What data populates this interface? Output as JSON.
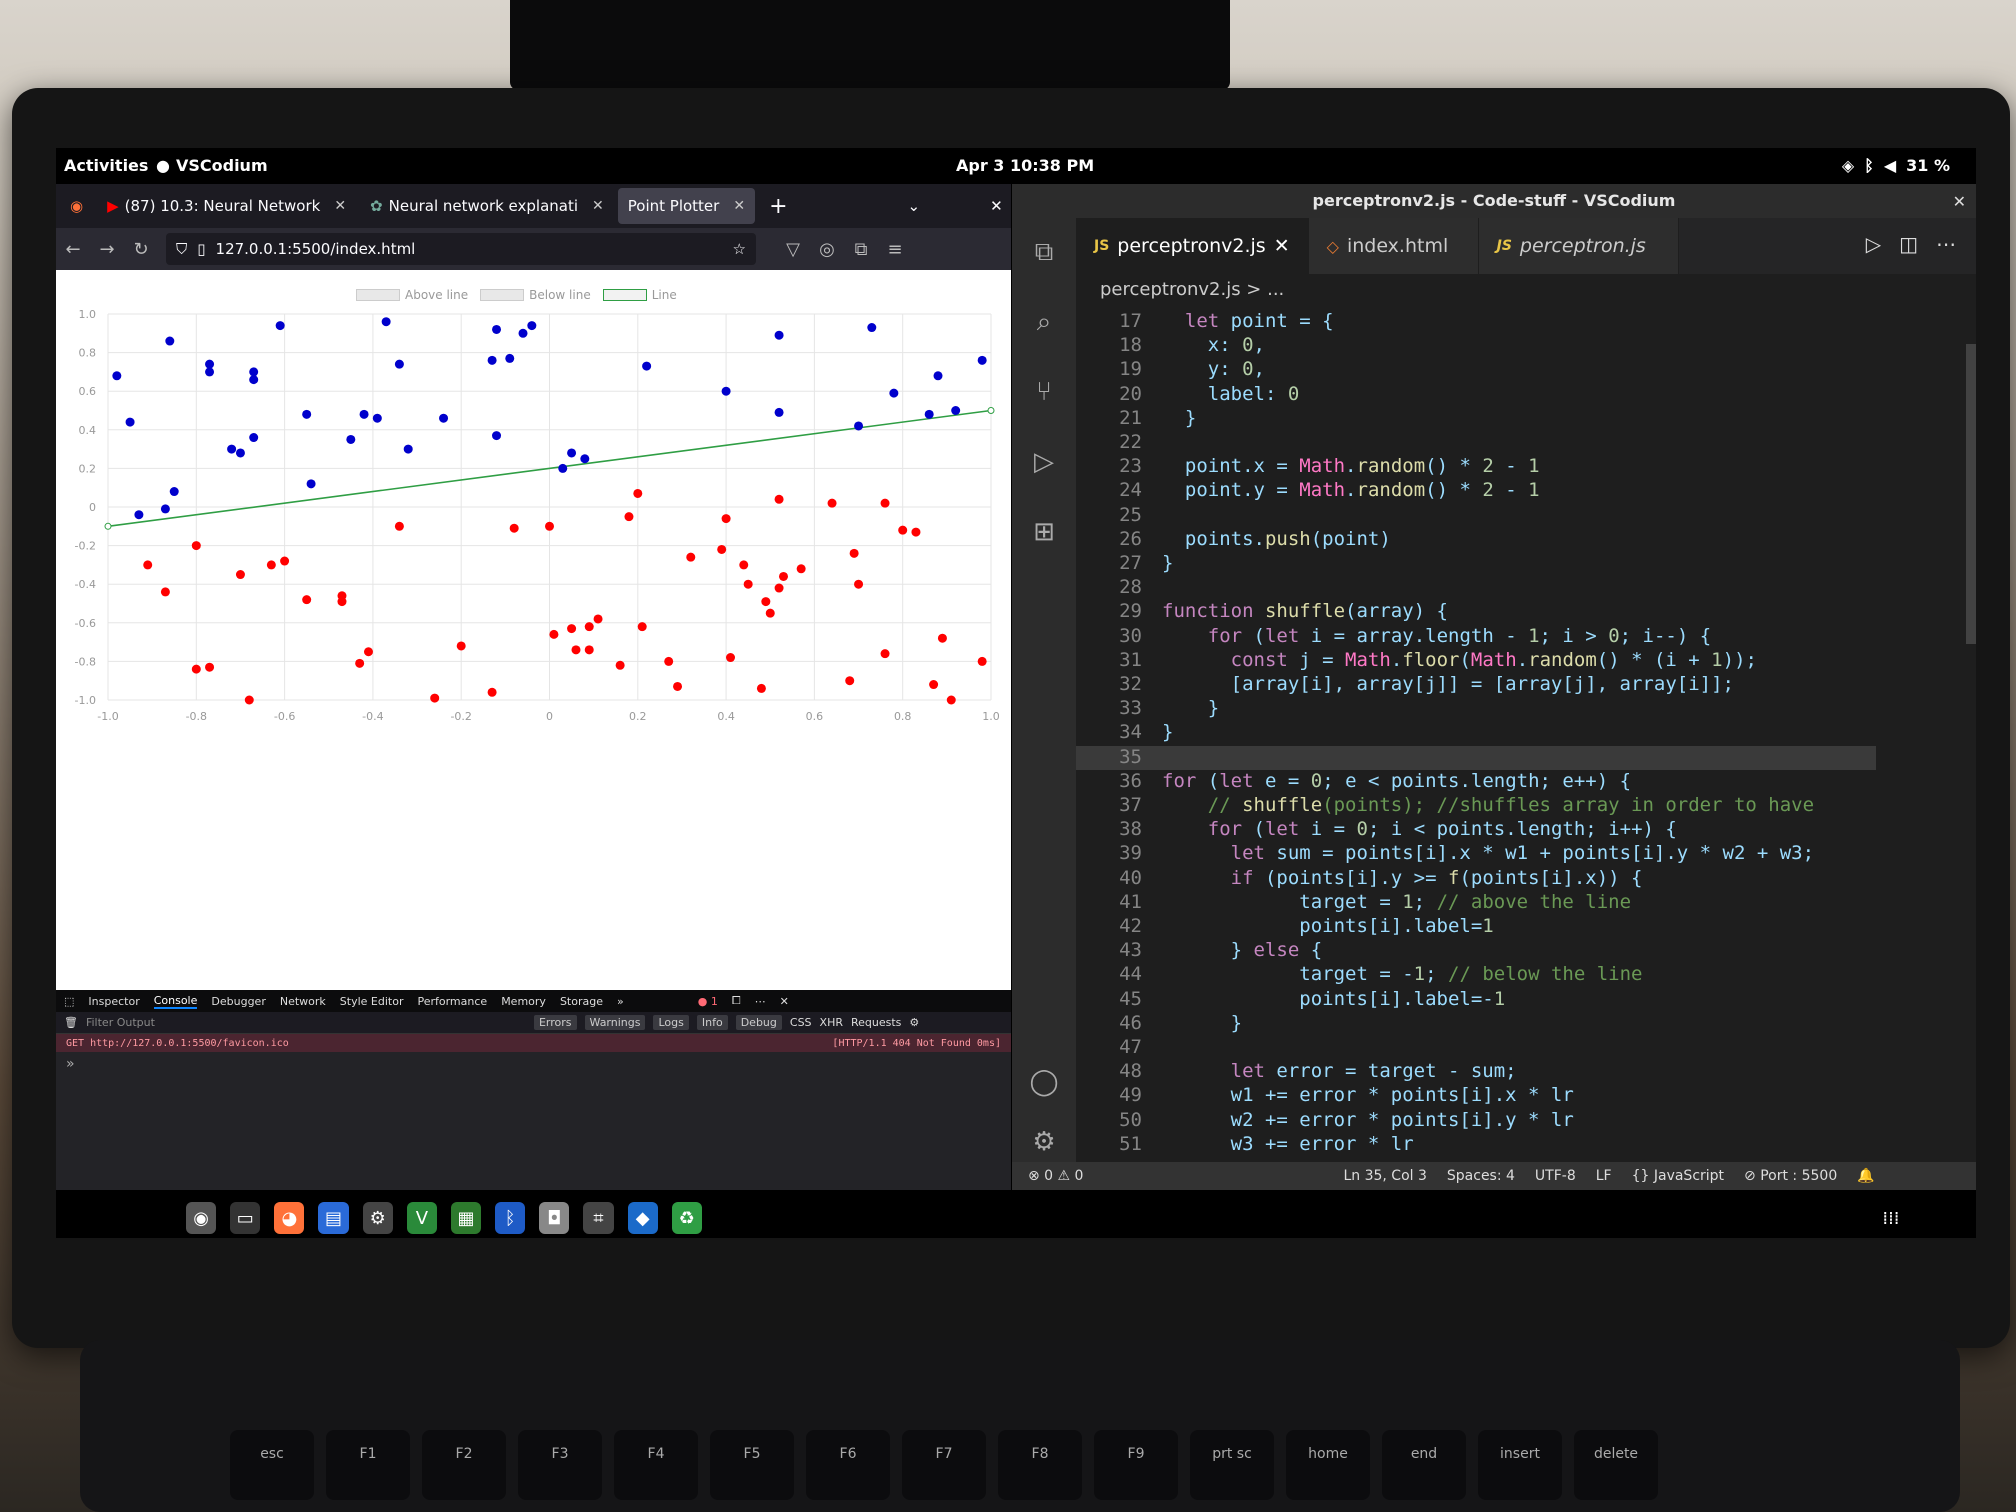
{
  "gnome": {
    "activities": "Activities",
    "app": "VSCodium",
    "clock": "Apr 3  10:38 PM",
    "battery": "31 %"
  },
  "firefox": {
    "tabs": [
      "(87) 10.3: Neural Network",
      "Neural network explanati",
      "Point Plotter"
    ],
    "url": "127.0.0.1:5500/index.html",
    "legend": [
      "Above line",
      "Below line",
      "Line"
    ],
    "devtools": {
      "tabs": [
        "Inspector",
        "Console",
        "Debugger",
        "Network",
        "Style Editor",
        "Performance",
        "Memory",
        "Storage"
      ],
      "filter": "Filter Output",
      "filters": [
        "Errors",
        "Warnings",
        "Logs",
        "Info",
        "Debug",
        "CSS",
        "XHR",
        "Requests"
      ],
      "error": "GET http://127.0.0.1:5500/favicon.ico",
      "error_status": "[HTTP/1.1 404 Not Found 0ms]",
      "prompt": "»",
      "error_count": "1"
    }
  },
  "chart_data": {
    "type": "scatter",
    "series": [
      {
        "name": "Above line",
        "color": "#0000cc",
        "points": [
          [
            -0.98,
            0.68
          ],
          [
            -0.95,
            0.44
          ],
          [
            -0.93,
            -0.04
          ],
          [
            -0.87,
            -0.01
          ],
          [
            -0.85,
            0.08
          ],
          [
            -0.86,
            0.86
          ],
          [
            -0.77,
            0.74
          ],
          [
            -0.77,
            0.7
          ],
          [
            -0.72,
            0.3
          ],
          [
            -0.7,
            0.28
          ],
          [
            -0.67,
            0.7
          ],
          [
            -0.67,
            0.66
          ],
          [
            -0.67,
            0.36
          ],
          [
            -0.61,
            0.94
          ],
          [
            -0.55,
            0.48
          ],
          [
            -0.54,
            0.12
          ],
          [
            -0.45,
            0.35
          ],
          [
            -0.42,
            0.48
          ],
          [
            -0.39,
            0.46
          ],
          [
            -0.37,
            0.96
          ],
          [
            -0.34,
            0.74
          ],
          [
            -0.32,
            0.3
          ],
          [
            -0.24,
            0.46
          ],
          [
            -0.13,
            0.76
          ],
          [
            -0.12,
            0.92
          ],
          [
            -0.12,
            0.37
          ],
          [
            -0.09,
            0.77
          ],
          [
            -0.06,
            0.9
          ],
          [
            -0.04,
            0.94
          ],
          [
            0.03,
            0.2
          ],
          [
            0.05,
            0.28
          ],
          [
            0.08,
            0.25
          ],
          [
            0.22,
            0.73
          ],
          [
            0.4,
            0.6
          ],
          [
            0.52,
            0.49
          ],
          [
            0.52,
            0.89
          ],
          [
            0.7,
            0.42
          ],
          [
            0.73,
            0.93
          ],
          [
            0.78,
            0.59
          ],
          [
            0.86,
            0.48
          ],
          [
            0.88,
            0.68
          ],
          [
            0.92,
            0.5
          ],
          [
            0.98,
            0.76
          ]
        ]
      },
      {
        "name": "Below line",
        "color": "#ff0000",
        "points": [
          [
            -0.91,
            -0.3
          ],
          [
            -0.87,
            -0.44
          ],
          [
            -0.8,
            -0.2
          ],
          [
            -0.8,
            -0.84
          ],
          [
            -0.77,
            -0.83
          ],
          [
            -0.7,
            -0.35
          ],
          [
            -0.68,
            -1.0
          ],
          [
            -0.63,
            -0.3
          ],
          [
            -0.6,
            -0.28
          ],
          [
            -0.55,
            -0.48
          ],
          [
            -0.47,
            -0.46
          ],
          [
            -0.47,
            -0.49
          ],
          [
            -0.43,
            -0.81
          ],
          [
            -0.41,
            -0.75
          ],
          [
            -0.34,
            -0.1
          ],
          [
            -0.26,
            -0.99
          ],
          [
            -0.2,
            -0.72
          ],
          [
            -0.13,
            -0.96
          ],
          [
            -0.08,
            -0.11
          ],
          [
            0.0,
            -0.1
          ],
          [
            0.01,
            -0.66
          ],
          [
            0.05,
            -0.63
          ],
          [
            0.06,
            -0.74
          ],
          [
            0.09,
            -0.62
          ],
          [
            0.09,
            -0.74
          ],
          [
            0.11,
            -0.58
          ],
          [
            0.16,
            -0.82
          ],
          [
            0.18,
            -0.05
          ],
          [
            0.2,
            0.07
          ],
          [
            0.21,
            -0.62
          ],
          [
            0.27,
            -0.8
          ],
          [
            0.29,
            -0.93
          ],
          [
            0.32,
            -0.26
          ],
          [
            0.39,
            -0.22
          ],
          [
            0.4,
            -0.06
          ],
          [
            0.41,
            -0.78
          ],
          [
            0.44,
            -0.3
          ],
          [
            0.45,
            -0.4
          ],
          [
            0.48,
            -0.94
          ],
          [
            0.49,
            -0.49
          ],
          [
            0.5,
            -0.55
          ],
          [
            0.52,
            0.04
          ],
          [
            0.52,
            -0.42
          ],
          [
            0.53,
            -0.36
          ],
          [
            0.57,
            -0.32
          ],
          [
            0.64,
            0.02
          ],
          [
            0.68,
            -0.9
          ],
          [
            0.69,
            -0.24
          ],
          [
            0.7,
            -0.4
          ],
          [
            0.76,
            0.02
          ],
          [
            0.76,
            -0.76
          ],
          [
            0.8,
            -0.12
          ],
          [
            0.83,
            -0.13
          ],
          [
            0.87,
            -0.92
          ],
          [
            0.89,
            -0.68
          ],
          [
            0.91,
            -1.0
          ],
          [
            0.98,
            -0.8
          ]
        ]
      }
    ],
    "line": {
      "name": "Line",
      "color": "#2f9e44",
      "x": [
        -1.0,
        1.0
      ],
      "y": [
        -0.1,
        0.5
      ]
    },
    "xlim": [
      -1,
      1
    ],
    "ylim": [
      -1,
      1
    ],
    "xticks": [
      "-1.0",
      "-0.8",
      "-0.6",
      "-0.4",
      "-0.2",
      "0",
      "0.2",
      "0.4",
      "0.6",
      "0.8",
      "1.0"
    ],
    "yticks": [
      "1.0",
      "0.8",
      "0.6",
      "0.4",
      "0.2",
      "0",
      "-0.2",
      "-0.4",
      "-0.6",
      "-0.8",
      "-1.0"
    ],
    "grid": true,
    "legend": "top-center"
  },
  "vscode": {
    "title": "perceptronv2.js - Code-stuff - VSCodium",
    "tabs": [
      "perceptronv2.js",
      "index.html",
      "perceptron.js"
    ],
    "breadcrumb": "perceptronv2.js > ...",
    "lines": [
      {
        "n": "17",
        "t": "  let point = {"
      },
      {
        "n": "18",
        "t": "    x: 0,"
      },
      {
        "n": "19",
        "t": "    y: 0,"
      },
      {
        "n": "20",
        "t": "    label: 0"
      },
      {
        "n": "21",
        "t": "  }"
      },
      {
        "n": "22",
        "t": ""
      },
      {
        "n": "23",
        "t": "  point.x = Math.random() * 2 - 1"
      },
      {
        "n": "24",
        "t": "  point.y = Math.random() * 2 - 1"
      },
      {
        "n": "25",
        "t": ""
      },
      {
        "n": "26",
        "t": "  points.push(point)"
      },
      {
        "n": "27",
        "t": "}"
      },
      {
        "n": "28",
        "t": ""
      },
      {
        "n": "29",
        "t": "function shuffle(array) {"
      },
      {
        "n": "30",
        "t": "    for (let i = array.length - 1; i > 0; i--) {"
      },
      {
        "n": "31",
        "t": "      const j = Math.floor(Math.random() * (i + 1));"
      },
      {
        "n": "32",
        "t": "      [array[i], array[j]] = [array[j], array[i]];"
      },
      {
        "n": "33",
        "t": "    }"
      },
      {
        "n": "34",
        "t": "}"
      },
      {
        "n": "35",
        "t": ""
      },
      {
        "n": "36",
        "t": "for (let e = 0; e < points.length; e++) {"
      },
      {
        "n": "37",
        "t": "    // shuffle(points); //shuffles array in order to have"
      },
      {
        "n": "38",
        "t": "    for (let i = 0; i < points.length; i++) {"
      },
      {
        "n": "39",
        "t": "      let sum = points[i].x * w1 + points[i].y * w2 + w3;"
      },
      {
        "n": "40",
        "t": "      if (points[i].y >= f(points[i].x)) {"
      },
      {
        "n": "41",
        "t": "            target = 1; // above the line"
      },
      {
        "n": "42",
        "t": "            points[i].label=1"
      },
      {
        "n": "43",
        "t": "      } else {"
      },
      {
        "n": "44",
        "t": "            target = -1; // below the line"
      },
      {
        "n": "45",
        "t": "            points[i].label=-1"
      },
      {
        "n": "46",
        "t": "      }"
      },
      {
        "n": "47",
        "t": ""
      },
      {
        "n": "48",
        "t": "      let error = target - sum;"
      },
      {
        "n": "49",
        "t": "      w1 += error * points[i].x * lr"
      },
      {
        "n": "50",
        "t": "      w2 += error * points[i].y * lr"
      },
      {
        "n": "51",
        "t": "      w3 += error * lr"
      }
    ],
    "status": {
      "problems": "⊗ 0 ⚠ 0",
      "pos": "Ln 35, Col 3",
      "spaces": "Spaces: 4",
      "enc": "UTF-8",
      "eol": "LF",
      "lang": "{} JavaScript",
      "port": "⊘ Port : 5500"
    }
  },
  "keyboard": [
    "esc",
    "F1",
    "F2",
    "F3",
    "F4",
    "F5",
    "F6",
    "F7",
    "F8",
    "F9",
    "prt sc",
    "home",
    "end",
    "insert",
    "delete"
  ]
}
